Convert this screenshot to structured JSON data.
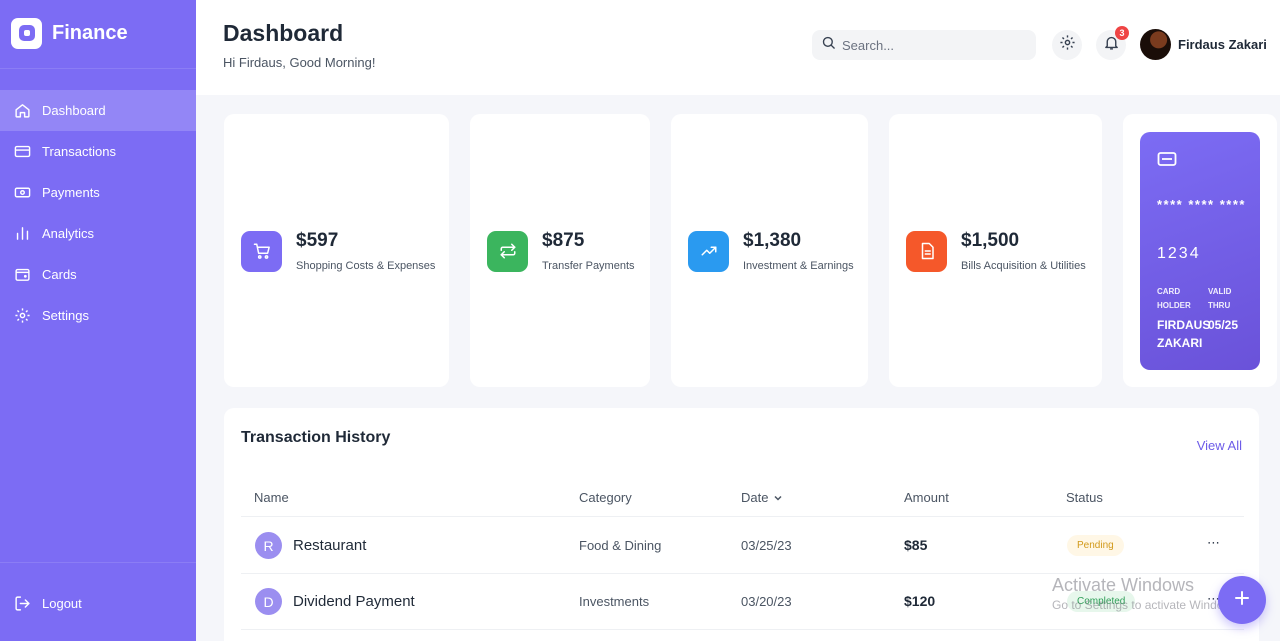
{
  "brand": {
    "name": "Finance",
    "icon": "logo-icon"
  },
  "sidebar": {
    "items": [
      {
        "label": "Dashboard",
        "icon": "home-icon",
        "active": true
      },
      {
        "label": "Transactions",
        "icon": "credit-card-icon"
      },
      {
        "label": "Payments",
        "icon": "money-icon"
      },
      {
        "label": "Analytics",
        "icon": "bar-chart-icon"
      },
      {
        "label": "Cards",
        "icon": "wallet-icon"
      },
      {
        "label": "Settings",
        "icon": "gear-icon"
      }
    ],
    "logout_label": "Logout"
  },
  "header": {
    "title": "Dashboard",
    "greeting": "Hi Firdaus, Good Morning!",
    "search_placeholder": "Search...",
    "notification_count": "3",
    "user_name": "Firdaus Zakari"
  },
  "stats": [
    {
      "value": "$597",
      "label": "Shopping Costs & Expenses",
      "icon": "cart-icon",
      "color": "#7c6cf4"
    },
    {
      "value": "$875",
      "label": "Transfer Payments",
      "icon": "transfer-icon",
      "color": "#3bb55e"
    },
    {
      "value": "$1,380",
      "label": "Investment & Earnings",
      "icon": "trend-up-icon",
      "color": "#2a9af0"
    },
    {
      "value": "$1,500",
      "label": "Bills Acquisition & Utilities",
      "icon": "document-icon",
      "color": "#f5582a"
    }
  ],
  "card": {
    "masked": "**** **** ****",
    "last4": "1234",
    "holder_key": "CARD HOLDER",
    "valid_key": "VALID THRU",
    "holder_value": "FIRDAUS ZAKARI",
    "valid_value": "05/25"
  },
  "transactions": {
    "title": "Transaction History",
    "view_all": "View All",
    "columns": {
      "name": "Name",
      "category": "Category",
      "date": "Date",
      "amount": "Amount",
      "status": "Status"
    },
    "rows": [
      {
        "initial": "R",
        "name": "Restaurant",
        "category": "Food & Dining",
        "date": "03/25/23",
        "amount": "$85",
        "status": "Pending"
      },
      {
        "initial": "D",
        "name": "Dividend Payment",
        "category": "Investments",
        "date": "03/20/23",
        "amount": "$120",
        "status": "Completed"
      }
    ],
    "more_label": "⋯"
  },
  "watermark": {
    "title": "Activate Windows",
    "subtitle": "Go to Settings to activate Windows."
  },
  "colors": {
    "accent": "#7c6cf4",
    "pending": "#d29a1b",
    "completed": "#2e9e57"
  }
}
